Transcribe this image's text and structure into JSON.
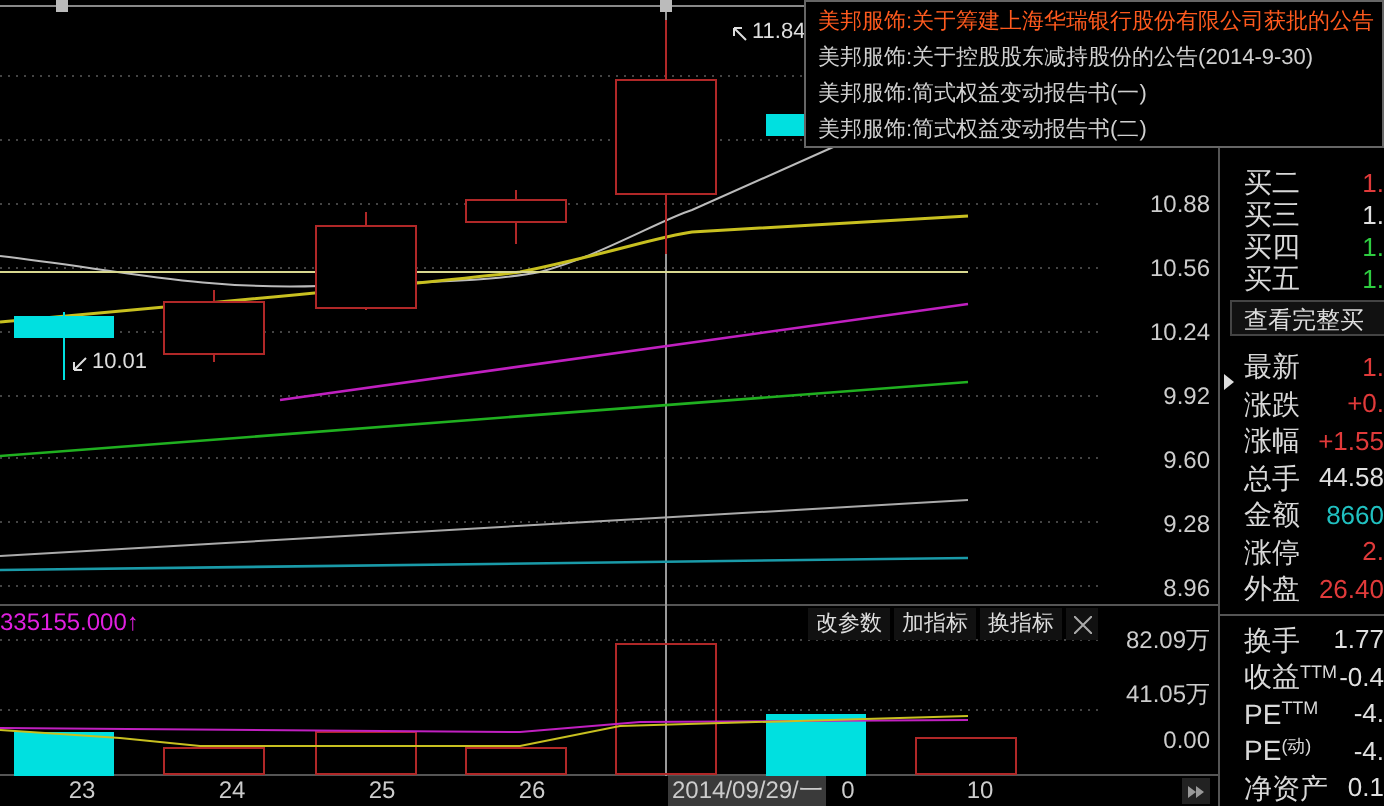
{
  "price_chart": {
    "axis_labels": [
      "10.88",
      "10.56",
      "10.24",
      "9.92",
      "9.60",
      "9.28",
      "8.96"
    ],
    "annotations": [
      {
        "text": "11.84"
      },
      {
        "text": "10.01"
      }
    ]
  },
  "volume_chart": {
    "reading": "335155.000↑",
    "buttons": [
      "改参数",
      "加指标",
      "换指标"
    ],
    "axis_labels": [
      "82.09万",
      "41.05万",
      "0.00"
    ]
  },
  "x_axis": {
    "labels": [
      "23",
      "24",
      "25",
      "26",
      "0",
      "10"
    ],
    "cursor_date": "2014/09/29/一"
  },
  "quote_panel": {
    "order_rows": [
      {
        "label": "买二",
        "value": "1.",
        "color": "#e03a3a"
      },
      {
        "label": "买三",
        "value": "1.",
        "color": "#e0e0e0"
      },
      {
        "label": "买四",
        "value": "1.",
        "color": "#2ecc40"
      },
      {
        "label": "买五",
        "value": "1.",
        "color": "#2ecc40"
      }
    ],
    "button": "查看完整买",
    "stats": [
      {
        "label": "最新",
        "value": "1.",
        "color": "#e03a3a"
      },
      {
        "label": "涨跌",
        "value": "+0.",
        "color": "#e03a3a"
      },
      {
        "label": "涨幅",
        "value": "+1.55",
        "color": "#e03a3a"
      },
      {
        "label": "总手",
        "value": "44.58",
        "color": "#e0e0e0"
      },
      {
        "label": "金额",
        "value": "8660",
        "color": "#20c0c0"
      },
      {
        "label": "涨停",
        "value": "2.",
        "color": "#e03a3a"
      },
      {
        "label": "外盘",
        "value": "26.40",
        "color": "#e03a3a"
      }
    ],
    "fundamentals": [
      {
        "label": "换手",
        "value": "1.77"
      },
      {
        "label": "收益$^{TTM}$",
        "value": "-0.4"
      },
      {
        "label": "PE$^{TTM}$",
        "value": "-4."
      },
      {
        "label": "PE$^{(动)}$",
        "value": "-4."
      },
      {
        "label": "净资产",
        "value": "0.1"
      }
    ]
  },
  "announcements": [
    {
      "text": "美邦服饰:关于筹建上海华瑞银行股份有限公司获批的公告",
      "selected": true
    },
    {
      "text": "美邦服饰:关于控股股东减持股份的公告(2014-9-30)",
      "selected": false
    },
    {
      "text": "美邦服饰:简式权益变动报告书(一)",
      "selected": false
    },
    {
      "text": "美邦服饰:简式权益变动报告书(二)",
      "selected": false
    }
  ]
}
